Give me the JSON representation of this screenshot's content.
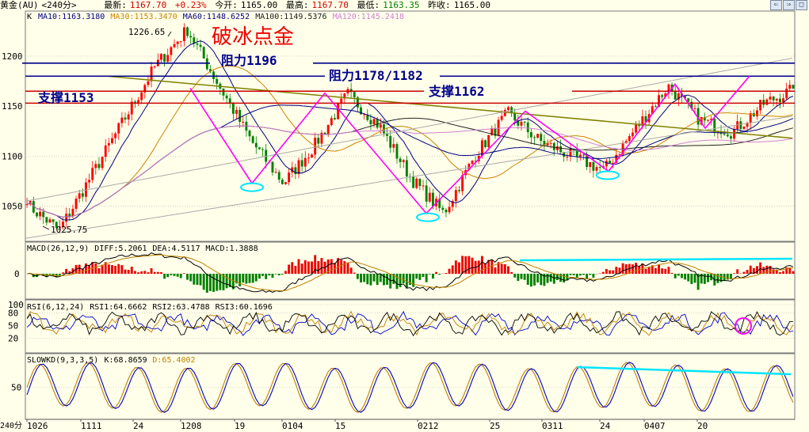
{
  "header": {
    "symbol": "黄金(AU)",
    "period": "<240分>",
    "latest_label": "最新:",
    "latest_value": "1167.70",
    "change": "+0.23%",
    "open_label": "今开:",
    "open_value": "1165.00",
    "high_label": "最高:",
    "high_value": "1167.70",
    "low_label": "最低:",
    "low_value": "1163.35",
    "prev_close_label": "昨收:",
    "prev_close_value": "1165.00"
  },
  "window_buttons": [
    "⇐",
    "⇒",
    "□"
  ],
  "chart_data": [
    {
      "type": "candlestick",
      "title": "破冰点金",
      "indicator_label": "K",
      "moving_averages": [
        {
          "name": "MA10",
          "value": "1163.3180",
          "color": "#000080"
        },
        {
          "name": "MA30",
          "value": "1153.3470",
          "color": "#cc8400"
        },
        {
          "name": "MA60",
          "value": "1148.6252",
          "color": "#000080"
        },
        {
          "name": "MA100",
          "value": "1149.5376",
          "color": "#202020"
        },
        {
          "name": "MA120",
          "value": "1145.2418",
          "color": "#d080d0"
        }
      ],
      "ylim": [
        1015,
        1245
      ],
      "y_ticks": [
        1050,
        1100,
        1150,
        1200
      ],
      "x_tick_labels": [
        "1026",
        "1111",
        "24",
        "1208",
        "19",
        "0104",
        "15",
        "0212",
        "25",
        "0311",
        "24",
        "0407",
        "20"
      ],
      "x_axis_unit": "240分",
      "price_path": [
        1052,
        1026,
        1080,
        1135,
        1190,
        1226.65,
        1170,
        1115,
        1073,
        1112,
        1162,
        1130,
        1077,
        1043,
        1102,
        1143,
        1115,
        1100,
        1086,
        1128,
        1170,
        1136,
        1124,
        1153,
        1167.7
      ],
      "annotations": {
        "high_label": "1226.65",
        "low_label": "1025.75",
        "resistance_1": "阻力1196",
        "resistance_2": "阻力1178/1182",
        "support_1": "支撑1162",
        "support_2": "支撑1153"
      },
      "levels": {
        "resistance_1": 1193,
        "resistance_2": 1180,
        "support_1": 1163,
        "support_2": 1153,
        "red_band_top": 1165
      }
    },
    {
      "type": "macd",
      "params": "MACD(26,12,9)",
      "values": [
        {
          "name": "DIFF",
          "value": "5.2061"
        },
        {
          "name": "DEA",
          "value": "4.5117"
        },
        {
          "name": "MACD",
          "value": "1.3888"
        }
      ],
      "y_ticks": [
        0
      ]
    },
    {
      "type": "rsi",
      "params": "RSI(6,12,24)",
      "values": [
        {
          "name": "RSI1",
          "value": "64.6662"
        },
        {
          "name": "RSI2",
          "value": "63.4788"
        },
        {
          "name": "RSI3",
          "value": "60.1696"
        }
      ],
      "y_ticks": [
        20,
        50,
        80,
        100
      ]
    },
    {
      "type": "stochastic",
      "params": "SLOWKD(9,3,3,5)",
      "values": [
        {
          "name": "K",
          "value": "68.8659"
        },
        {
          "name": "D",
          "value": "65.4002"
        }
      ],
      "y_ticks": [
        50
      ]
    }
  ],
  "colors": {
    "background": "#ffffea",
    "up_candle": "#ff0000",
    "down_candle": "#008000",
    "resistance": "#00008b",
    "support": "#cc0000",
    "pattern": "#ff00ff",
    "highlight": "#00e5ff",
    "trend": "#808000",
    "title": "#ee0000"
  }
}
